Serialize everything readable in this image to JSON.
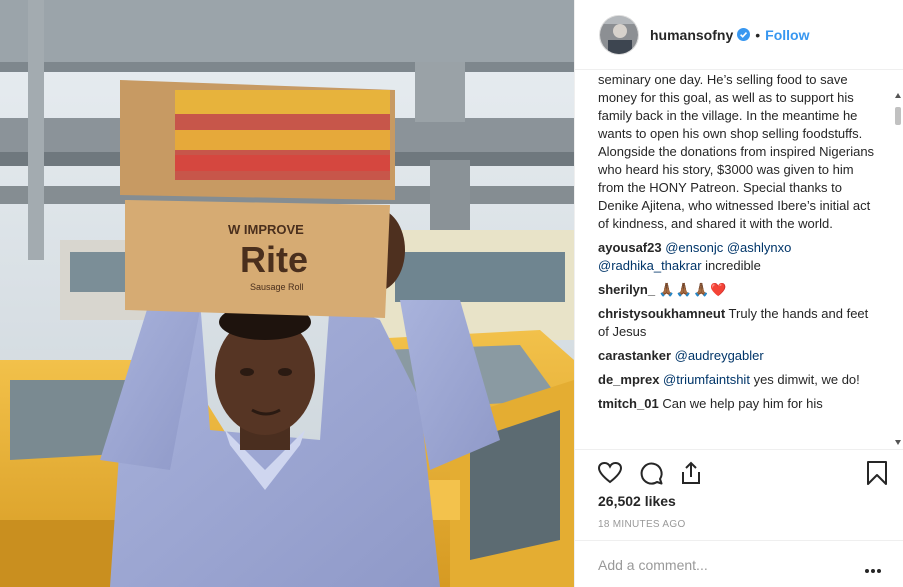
{
  "colors": {
    "link_blue": "#3897f0",
    "mention_blue": "#003569",
    "text": "#262626",
    "muted": "#999999",
    "border": "#efefef"
  },
  "photo": {
    "box_brand": "Rite",
    "box_top_text": "W IMPROVE",
    "box_sub_text": "Sausage Roll"
  },
  "header": {
    "username": "humansofny",
    "verified_icon": "verified-badge-icon",
    "separator": "•",
    "follow_label": "Follow"
  },
  "caption": "seminary one day. He’s selling food to save money for this goal, as well as to support his family back in the village. In the meantime he wants to open his own shop selling foodstuffs. Alongside the donations from inspired Nigerians who heard his story, $3000 was given to him from the HONY Patreon. Special thanks to Denike Ajitena, who witnessed Ibere’s initial act of kindness, and shared it with the world.",
  "comments": [
    {
      "user": "ayousaf23",
      "mentions": [
        "@ensonjc",
        "@ashlynxo",
        "@radhika_thakrar"
      ],
      "text": "incredible"
    },
    {
      "user": "sherilyn_",
      "text": "🙏🏾🙏🏾🙏🏾❤️"
    },
    {
      "user": "christysoukhamneut",
      "text": "Truly the hands and feet of Jesus"
    },
    {
      "user": "carastanker",
      "mentions": [
        "@audreygabler"
      ],
      "text": ""
    },
    {
      "user": "de_mprex",
      "mentions": [
        "@triumfaintshit"
      ],
      "text": "yes dimwit, we do!"
    },
    {
      "user": "tmitch_01",
      "text": "Can we help pay him for his"
    }
  ],
  "actions": {
    "like_icon": "heart-icon",
    "comment_icon": "comment-icon",
    "share_icon": "share-icon",
    "save_icon": "bookmark-icon"
  },
  "likes": "26,502 likes",
  "timestamp": "18 MINUTES AGO",
  "add_comment": {
    "placeholder": "Add a comment...",
    "more_icon": "more-options-icon"
  }
}
